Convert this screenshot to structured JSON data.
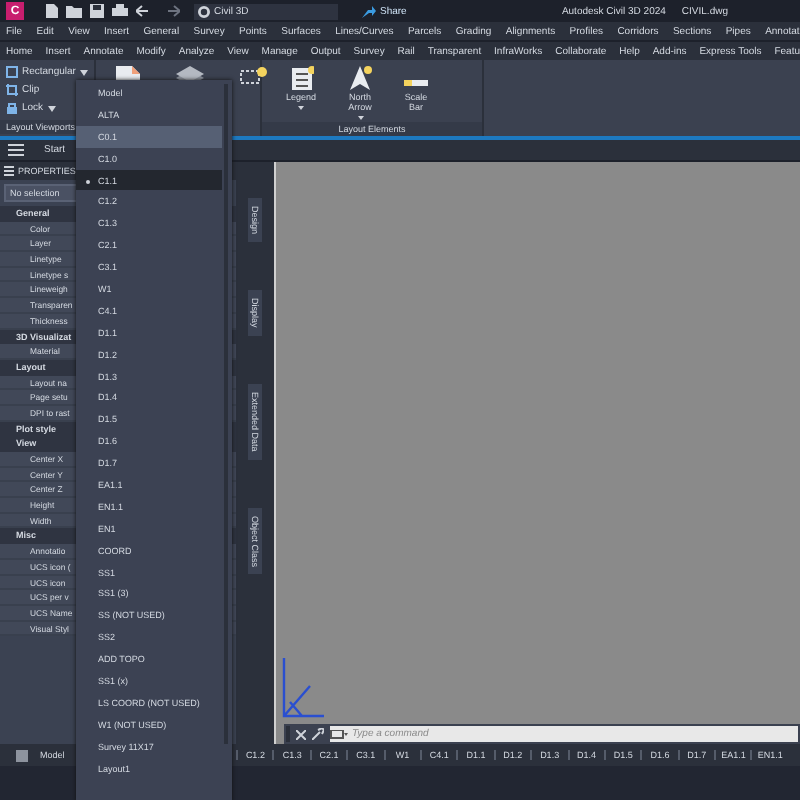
{
  "title_bar": {
    "app_letter": "C",
    "workspace": "Civil 3D",
    "share": "Share",
    "title": "Autodesk Civil 3D 2024",
    "filename": "CIVIL.dwg"
  },
  "menu_bar": [
    "File",
    "Edit",
    "View",
    "Insert",
    "General",
    "Survey",
    "Points",
    "Surfaces",
    "Lines/Curves",
    "Parcels",
    "Grading",
    "Alignments",
    "Profiles",
    "Corridors",
    "Sections",
    "Pipes",
    "Annotat"
  ],
  "ribbon_tabs": [
    "Home",
    "Insert",
    "Annotate",
    "Modify",
    "Analyze",
    "View",
    "Manage",
    "Output",
    "Survey",
    "Rail",
    "Transparent",
    "InfraWorks",
    "Collaborate",
    "Help",
    "Add-ins",
    "Express Tools",
    "Featu"
  ],
  "ribbon": {
    "viewports": {
      "title": "Layout Viewports",
      "tools": [
        {
          "label": "Rectangular",
          "dropdown": true
        },
        {
          "label": "Clip",
          "dropdown": false
        },
        {
          "label": "Lock",
          "dropdown": true
        }
      ]
    },
    "elements": {
      "title": "Layout Elements",
      "tools": [
        {
          "kind": "legend",
          "label": "Legend",
          "dropdown": true
        },
        {
          "kind": "north",
          "label": "North\nArrow",
          "dropdown": true
        },
        {
          "kind": "scale",
          "label": "Scale\nBar",
          "dropdown": false
        }
      ]
    }
  },
  "file_tabs": [
    "Start"
  ],
  "properties": {
    "title": "PROPERTIES",
    "selection": "No selection",
    "rows": [
      {
        "kind": "category",
        "label": "General"
      },
      {
        "kind": "property",
        "label": "Color"
      },
      {
        "kind": "property",
        "label": "Layer"
      },
      {
        "kind": "property",
        "label": "Linetype"
      },
      {
        "kind": "property",
        "label": "Linetype s"
      },
      {
        "kind": "property",
        "label": "Lineweigh"
      },
      {
        "kind": "property",
        "label": "Transparen"
      },
      {
        "kind": "property",
        "label": "Thickness"
      },
      {
        "kind": "category",
        "label": "3D Visualizat"
      },
      {
        "kind": "property",
        "label": "Material"
      },
      {
        "kind": "category",
        "label": "Layout"
      },
      {
        "kind": "property",
        "label": "Layout na"
      },
      {
        "kind": "property",
        "label": "Page setu"
      },
      {
        "kind": "property",
        "label": "DPI to rast"
      },
      {
        "kind": "category",
        "label": "Plot style"
      },
      {
        "kind": "category",
        "label": "View"
      },
      {
        "kind": "property",
        "label": "Center X"
      },
      {
        "kind": "property",
        "label": "Center Y"
      },
      {
        "kind": "property",
        "label": "Center Z"
      },
      {
        "kind": "property",
        "label": "Height"
      },
      {
        "kind": "property",
        "label": "Width"
      },
      {
        "kind": "category",
        "label": "Misc"
      },
      {
        "kind": "property",
        "label": "Annotatio"
      },
      {
        "kind": "property",
        "label": "UCS icon ("
      },
      {
        "kind": "property",
        "label": "UCS icon"
      },
      {
        "kind": "property",
        "label": "UCS per v"
      },
      {
        "kind": "property",
        "label": "UCS Name"
      },
      {
        "kind": "property",
        "label": "Visual Styl"
      }
    ]
  },
  "palette_tabs": [
    "Design",
    "Display",
    "Extended Data",
    "Object Class"
  ],
  "layout_menu": [
    {
      "label": "Model",
      "selected": false,
      "hovered": false
    },
    {
      "label": "ALTA",
      "selected": false,
      "hovered": false
    },
    {
      "label": "C0.1",
      "selected": false,
      "hovered": true
    },
    {
      "label": "C1.0",
      "selected": false,
      "hovered": false
    },
    {
      "label": "C1.1",
      "selected": true,
      "hovered": false
    },
    {
      "label": "C1.2",
      "selected": false,
      "hovered": false
    },
    {
      "label": "C1.3",
      "selected": false,
      "hovered": false
    },
    {
      "label": "C2.1",
      "selected": false,
      "hovered": false
    },
    {
      "label": "C3.1",
      "selected": false,
      "hovered": false
    },
    {
      "label": "W1",
      "selected": false,
      "hovered": false
    },
    {
      "label": "C4.1",
      "selected": false,
      "hovered": false
    },
    {
      "label": "D1.1",
      "selected": false,
      "hovered": false
    },
    {
      "label": "D1.2",
      "selected": false,
      "hovered": false
    },
    {
      "label": "D1.3",
      "selected": false,
      "hovered": false
    },
    {
      "label": "D1.4",
      "selected": false,
      "hovered": false
    },
    {
      "label": "D1.5",
      "selected": false,
      "hovered": false
    },
    {
      "label": "D1.6",
      "selected": false,
      "hovered": false
    },
    {
      "label": "D1.7",
      "selected": false,
      "hovered": false
    },
    {
      "label": "EA1.1",
      "selected": false,
      "hovered": false
    },
    {
      "label": "EN1.1",
      "selected": false,
      "hovered": false
    },
    {
      "label": "EN1",
      "selected": false,
      "hovered": false
    },
    {
      "label": "COORD",
      "selected": false,
      "hovered": false
    },
    {
      "label": "SS1",
      "selected": false,
      "hovered": false
    },
    {
      "label": "SS1 (3)",
      "selected": false,
      "hovered": false
    },
    {
      "label": "SS (NOT USED)",
      "selected": false,
      "hovered": false
    },
    {
      "label": "SS2",
      "selected": false,
      "hovered": false
    },
    {
      "label": "ADD TOPO",
      "selected": false,
      "hovered": false
    },
    {
      "label": "SS1 (x)",
      "selected": false,
      "hovered": false
    },
    {
      "label": "LS COORD (NOT USED)",
      "selected": false,
      "hovered": false
    },
    {
      "label": "W1 (NOT USED)",
      "selected": false,
      "hovered": false
    },
    {
      "label": "Survey 11X17",
      "selected": false,
      "hovered": false
    },
    {
      "label": "Layout1",
      "selected": false,
      "hovered": false
    }
  ],
  "command_line": {
    "placeholder": "Type a command"
  },
  "layout_tabs": [
    "Model",
    "C1.2",
    "C1.3",
    "C2.1",
    "C3.1",
    "W1",
    "C4.1",
    "D1.1",
    "D1.2",
    "D1.3",
    "D1.4",
    "D1.5",
    "D1.6",
    "D1.7",
    "EA1.1",
    "EN1.1"
  ]
}
